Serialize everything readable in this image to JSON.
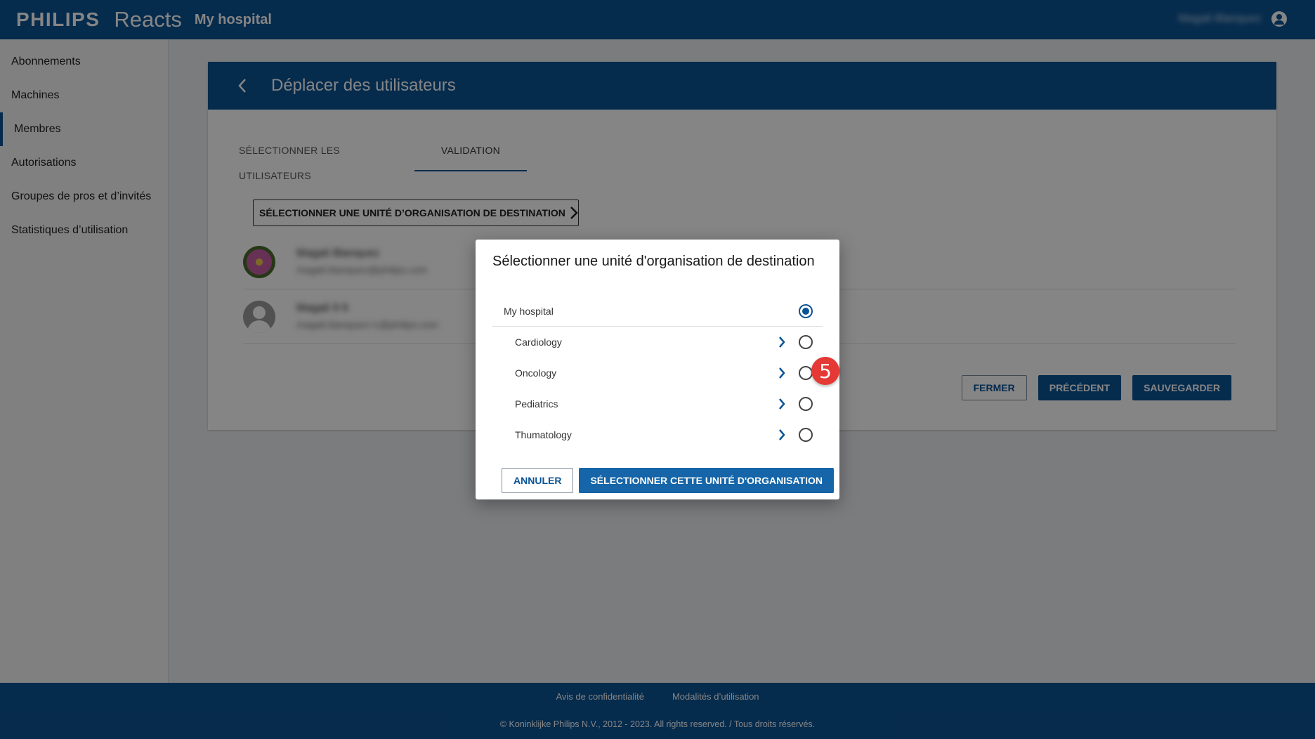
{
  "header": {
    "brand": "PHILIPS",
    "product": "Reacts",
    "hospital": "My hospital",
    "user_name": "Magali Blanquez"
  },
  "sidebar": {
    "items": [
      {
        "label": "Abonnements"
      },
      {
        "label": "Machines"
      },
      {
        "label": "Membres",
        "active": true
      },
      {
        "label": "Autorisations"
      },
      {
        "label": "Groupes de pros et d’invités"
      },
      {
        "label": "Statistiques d’utilisation"
      }
    ]
  },
  "card": {
    "title": "Déplacer des utilisateurs",
    "tabs": [
      {
        "label": "SÉLECTIONNER LES UTILISATEURS"
      },
      {
        "label": "VALIDATION",
        "active": true
      }
    ],
    "destination_button": "SÉLECTIONNER UNE UNITÉ D’ORGANISATION DE DESTINATION",
    "members": [
      {
        "name": "Magali Blanquez",
        "email": "magali.blanquez@philips.com"
      },
      {
        "name": "Magali 9 6",
        "email": "magali.blanquez+1@philips.com"
      }
    ],
    "actions": {
      "close": "FERMER",
      "previous": "PRÉCÉDENT",
      "save": "SAUVEGARDER"
    }
  },
  "dialog": {
    "title": "Sélectionner une unité d'organisation de destination",
    "root": {
      "label": "My hospital",
      "selected": true
    },
    "units": [
      {
        "label": "Cardiology"
      },
      {
        "label": "Oncology"
      },
      {
        "label": "Pediatrics"
      },
      {
        "label": "Thumatology"
      }
    ],
    "step_number": "5",
    "cancel": "ANNULER",
    "confirm": "SÉLECTIONNER CETTE UNITÉ D'ORGANISATION"
  },
  "footer": {
    "privacy": "Avis de confidentialité",
    "terms": "Modalités d’utilisation",
    "copyright": "© Koninklijke Philips N.V., 2012 - 2023. All rights reserved. / Tous droits réservés."
  },
  "colors": {
    "primary": "#0b5394",
    "badge": "#e53935"
  }
}
